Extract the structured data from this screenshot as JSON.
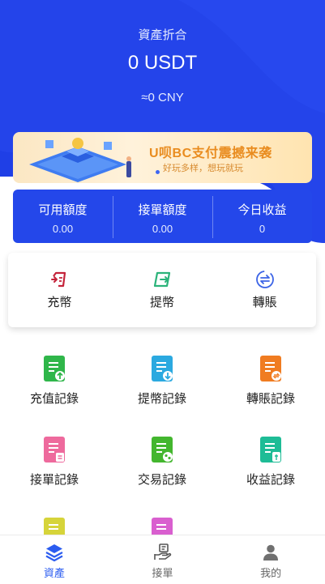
{
  "assets": {
    "label": "資產折合",
    "value": "0 USDT",
    "cny": "≈0 CNY"
  },
  "banner": {
    "title": "U呗BC支付震撼来袭",
    "subtitle": "好玩多样，想玩就玩"
  },
  "stats": [
    {
      "label": "可用額度",
      "value": "0.00"
    },
    {
      "label": "接單額度",
      "value": "0.00"
    },
    {
      "label": "今日收益",
      "value": "0"
    }
  ],
  "actions": [
    {
      "label": "充幣",
      "icon": "deposit-icon"
    },
    {
      "label": "提幣",
      "icon": "withdraw-icon"
    },
    {
      "label": "轉賬",
      "icon": "transfer-icon"
    }
  ],
  "records": [
    {
      "label": "充值記錄",
      "icon": "recharge-record-icon",
      "color": "#2fb64a"
    },
    {
      "label": "提幣記錄",
      "icon": "withdraw-record-icon",
      "color": "#2ba9e0"
    },
    {
      "label": "轉賬記錄",
      "icon": "transfer-record-icon",
      "color": "#f07c21"
    },
    {
      "label": "接單記錄",
      "icon": "order-record-icon",
      "color": "#ee6a9d"
    },
    {
      "label": "交易記錄",
      "icon": "trade-record-icon",
      "color": "#43b62e"
    },
    {
      "label": "收益記錄",
      "icon": "income-record-icon",
      "color": "#1ebc96"
    },
    {
      "label": "",
      "icon": "record-icon-7",
      "color": "#d6d43a"
    },
    {
      "label": "",
      "icon": "record-icon-8",
      "color": "#d95fcf"
    }
  ],
  "tabs": [
    {
      "label": "資產",
      "icon": "layers-icon",
      "active": true
    },
    {
      "label": "接單",
      "icon": "hand-icon",
      "active": false
    },
    {
      "label": "我的",
      "icon": "user-icon",
      "active": false
    }
  ],
  "colors": {
    "brand": "#2447ea",
    "active_tab": "#2b5cf0",
    "banner_text": "#e98c1f"
  }
}
